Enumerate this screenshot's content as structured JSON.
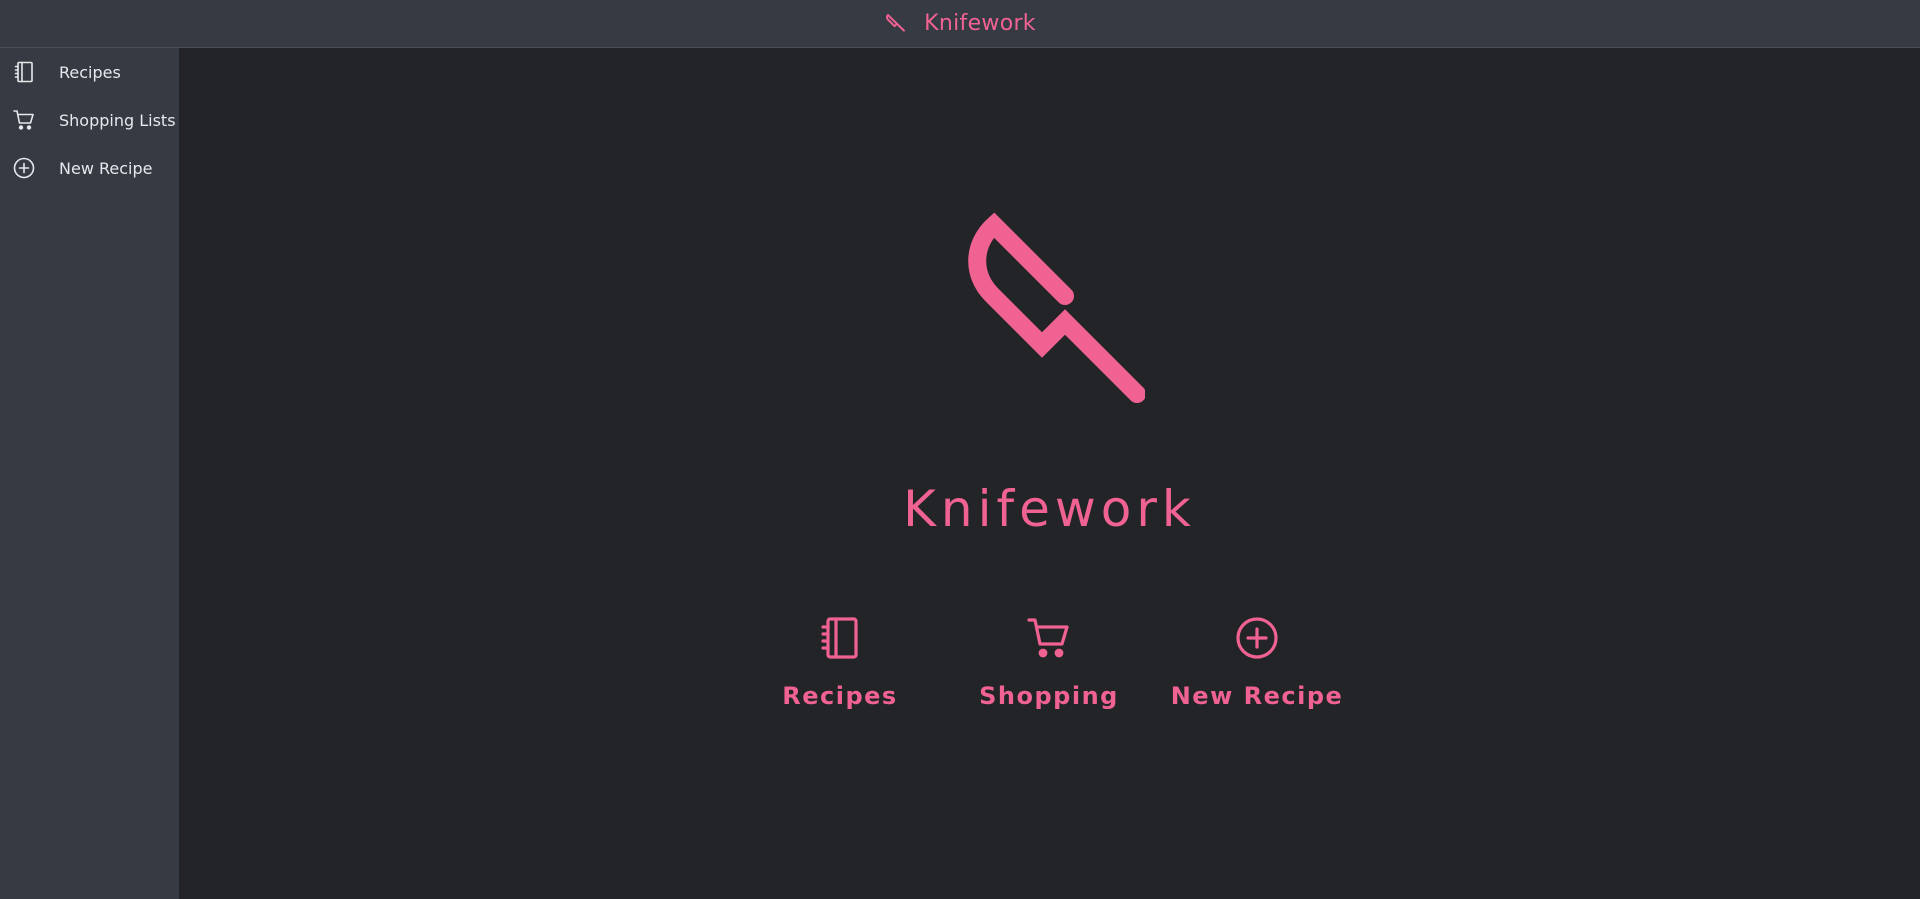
{
  "app": {
    "title": "Knifework",
    "accent_color": "#f06292",
    "brand_icon": "knife-icon"
  },
  "sidebar": {
    "items": [
      {
        "label": "Recipes",
        "icon": "notebook-icon"
      },
      {
        "label": "Shopping Lists",
        "icon": "cart-icon"
      },
      {
        "label": "New Recipe",
        "icon": "plus-circle-icon"
      }
    ]
  },
  "main": {
    "hero_title": "Knifework",
    "hero_icon": "knife-icon",
    "actions": [
      {
        "label": "Recipes",
        "icon": "notebook-icon"
      },
      {
        "label": "Shopping",
        "icon": "cart-icon"
      },
      {
        "label": "New Recipe",
        "icon": "plus-circle-icon"
      }
    ]
  }
}
